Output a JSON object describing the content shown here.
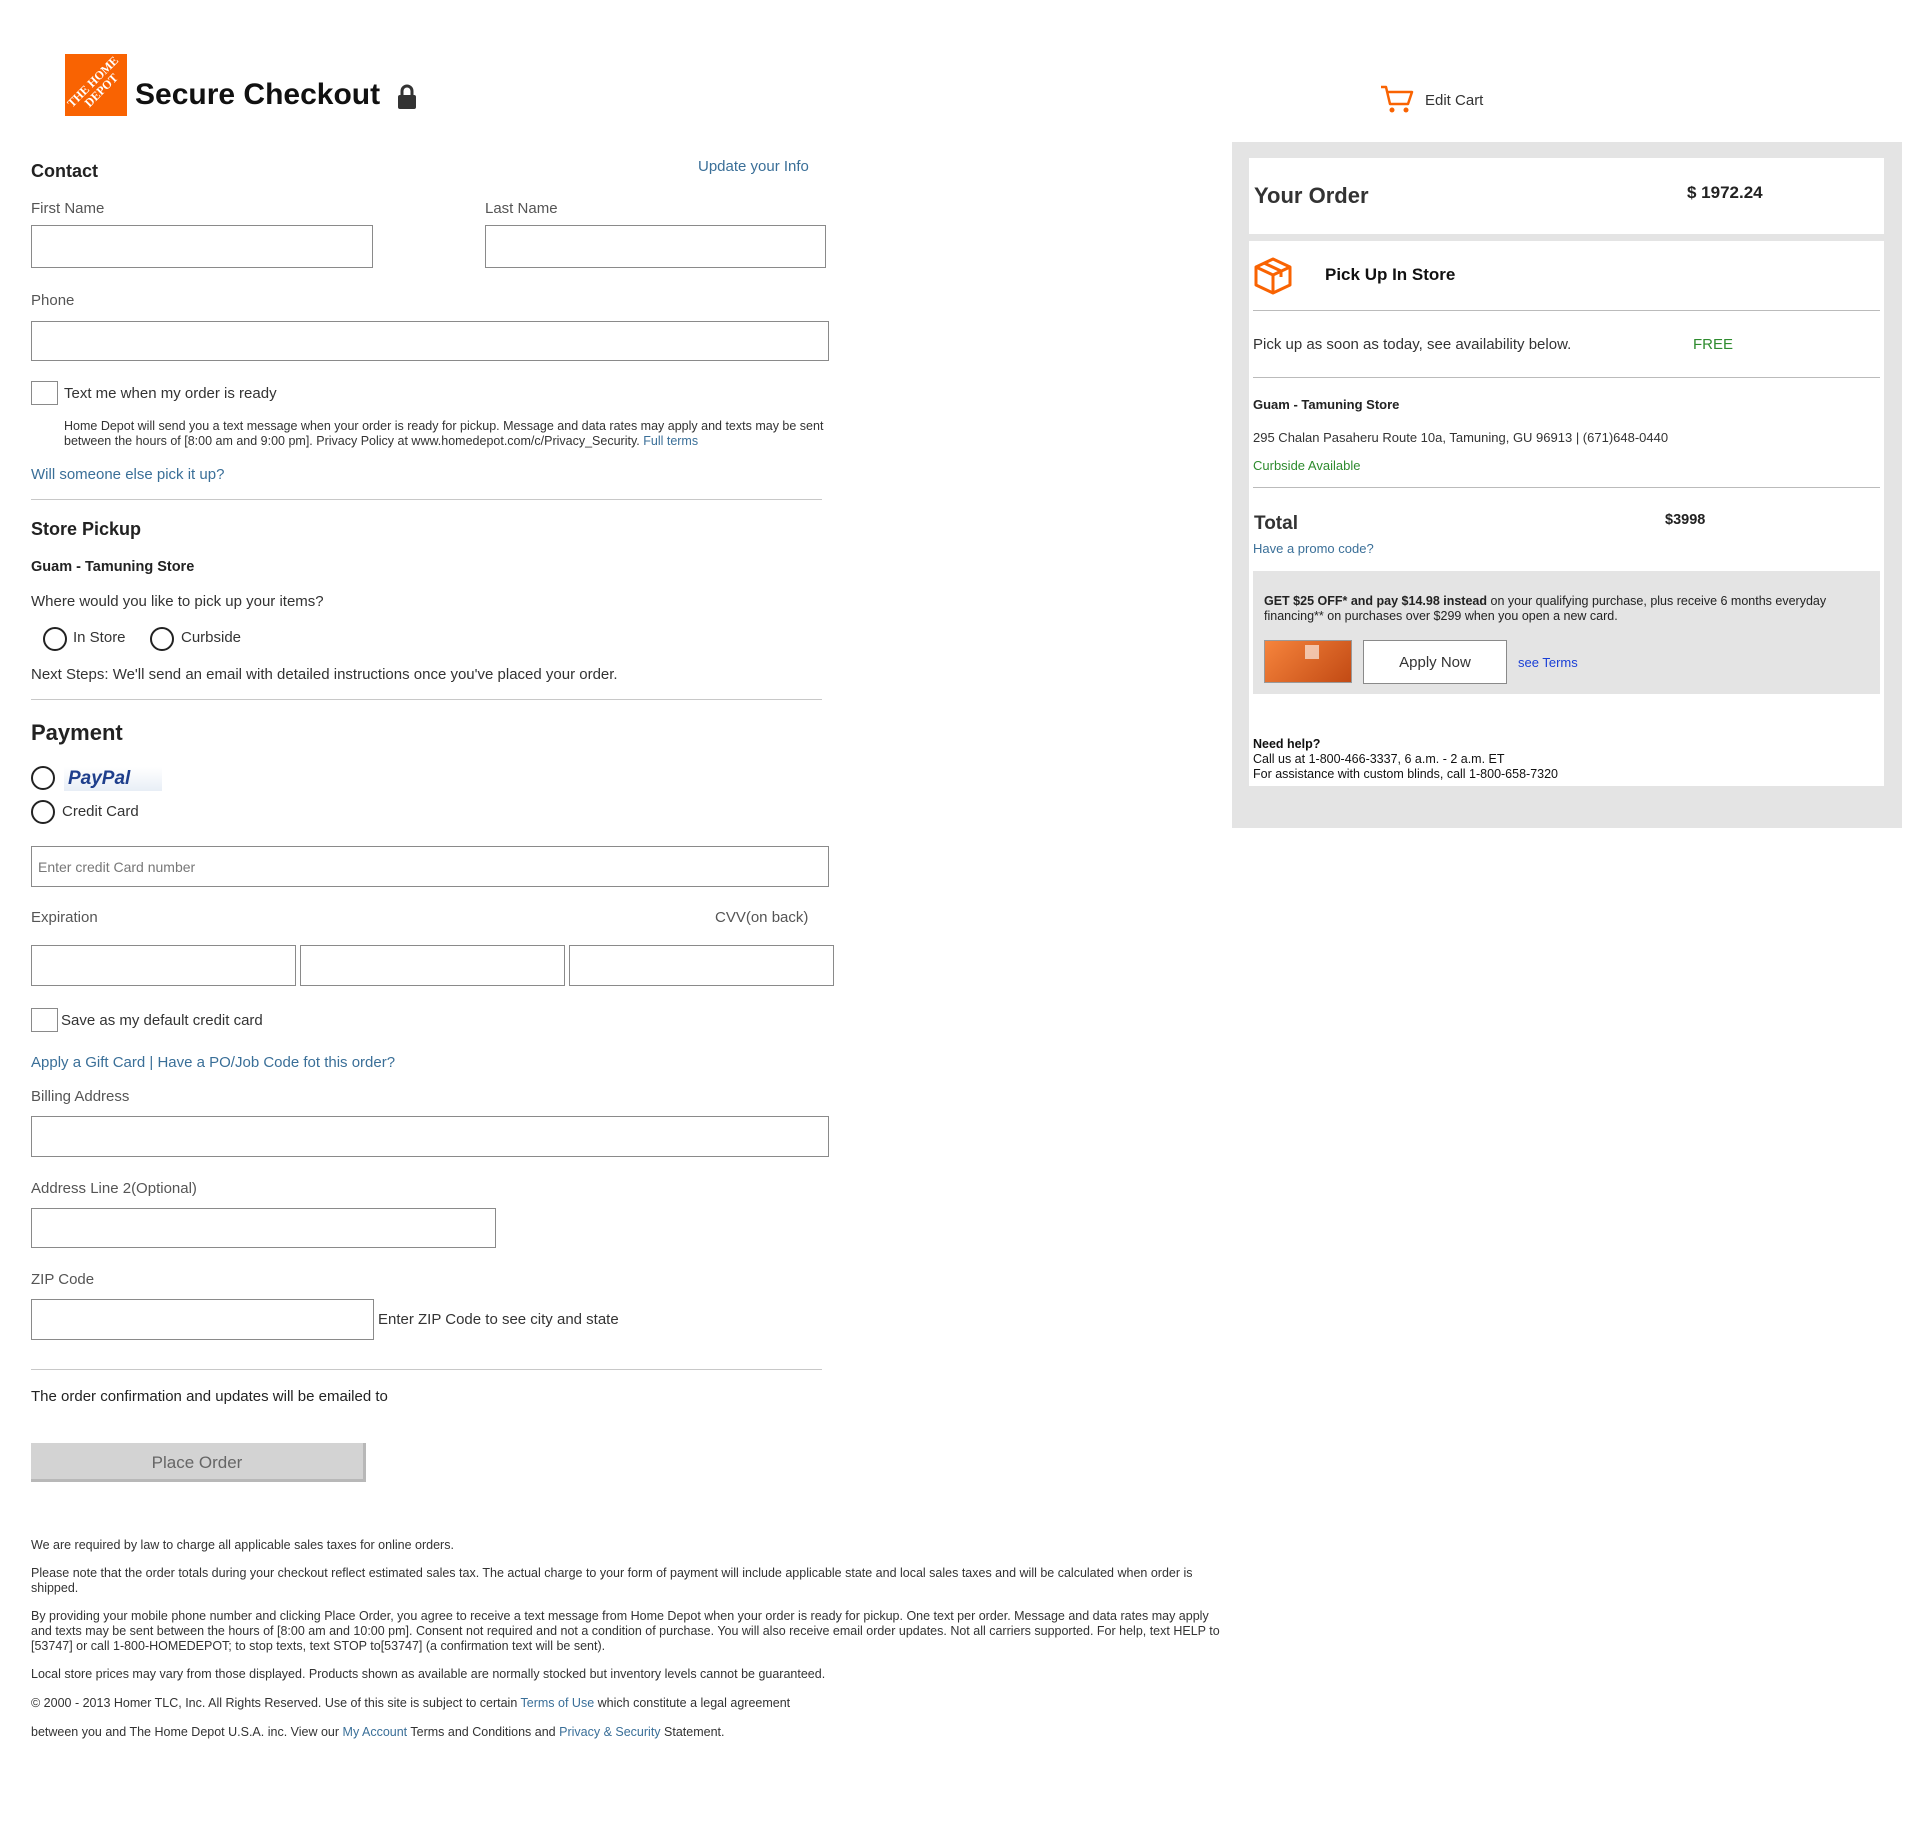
{
  "header": {
    "logo_text": "THE HOME DEPOT",
    "title": "Secure Checkout",
    "edit_cart_label": "Edit Cart"
  },
  "contact": {
    "title": "Contact",
    "update_link": "Update your Info",
    "first_name_label": "First Name",
    "last_name_label": "Last Name",
    "phone_label": "Phone",
    "text_me_label": "Text me when my order is ready",
    "text_disclaimer": "Home Depot will send you a text message when your order is ready for pickup. Message and data rates may apply and texts may be sent between the hours of [8:00 am and 9:00 pm]. Privacy Policy at www.homedepot.com/c/Privacy_Security.",
    "full_terms_link": "Full terms",
    "someone_else_link": "Will someone else pick it up?"
  },
  "store_pickup": {
    "title": "Store Pickup",
    "store_name": "Guam - Tamuning Store",
    "question": "Where would you like to pick up your items?",
    "options": [
      "In Store",
      "Curbside"
    ],
    "next_steps": "Next Steps: We'll send an email with detailed instructions once you've placed your order."
  },
  "payment": {
    "title": "Payment",
    "paypal_label": "PayPal",
    "credit_card_label": "Credit Card",
    "card_number_placeholder": "Enter credit Card number",
    "expiration_label": "Expiration",
    "cvv_label": "CVV(on back)",
    "save_default_label": "Save as my default credit card",
    "gift_card_link": "Apply a Gift Card | Have a PO/Job Code fot this order?",
    "billing_address_label": "Billing Address",
    "address2_label": "Address Line 2(Optional)",
    "zip_label": "ZIP Code",
    "zip_hint": "Enter ZIP Code to see city and state",
    "confirmation_text": "The order confirmation and updates will be emailed to",
    "place_order_label": "Place Order"
  },
  "footer": {
    "line1": "We are required by law to charge all applicable sales taxes for online orders.",
    "line2": "Please note that the order totals during your checkout reflect estimated sales tax. The actual charge to your form of payment will include applicable state and local sales taxes and will be calculated when order is shipped.",
    "line3": "By providing your mobile phone number and clicking Place Order, you agree to receive a text message from Home Depot when your order is ready for pickup. One text per order. Message and data rates may apply and texts may be sent between the hours of [8:00 am and 10:00 pm]. Consent not required and not a condition of purchase. You will also receive email order updates. Not all carriers supported. For help, text HELP to [53747] or call 1-800-HOMEDEPOT; to stop texts, text STOP to[53747] (a confirmation text will be sent).",
    "line4": "Local store prices may vary from those displayed. Products shown as available are normally stocked but inventory levels cannot be guaranteed.",
    "line5_pre": "© 2000 - 2013 Homer TLC, Inc. All Rights Reserved. Use of this site is subject to certain",
    "line5_link": "Terms of Use",
    "line5_post": "which constitute a legal agreement",
    "line6_pre": "between you and The Home Depot U.S.A. inc. View our",
    "line6_link1": "My Account",
    "line6_mid": "Terms and Conditions and",
    "line6_link2": "Privacy & Security",
    "line6_post": "Statement."
  },
  "order": {
    "title": "Your Order",
    "amount": "$ 1972.24",
    "pickup_title": "Pick Up In Store",
    "pickup_desc": "Pick up as soon as today, see availability below.",
    "pickup_price": "FREE",
    "store_name": "Guam - Tamuning Store",
    "store_address": "295 Chalan Pasaheru Route 10a, Tamuning, GU 96913 | (671)648-0440",
    "curbside": "Curbside Available",
    "total_label": "Total",
    "total_amount": "$3998",
    "promo_link": "Have a promo code?",
    "promo_bold": "GET $25 OFF* and pay $14.98 instead",
    "promo_rest": "on your qualifying purchase, plus receive 6 months everyday financing** on purchases over $299 when you open a new card.",
    "apply_now": "Apply Now",
    "see_terms": "see Terms",
    "help_title": "Need help?",
    "help_line1": "Call us at 1-800-466-3337, 6 a.m. - 2 a.m. ET",
    "help_line2": "For assistance with custom blinds, call 1-800-658-7320"
  },
  "colors": {
    "brand_orange": "#f96302",
    "link_blue": "#3a6f98",
    "free_green": "#2e8b2e",
    "panel_gray": "#e4e4e4"
  }
}
